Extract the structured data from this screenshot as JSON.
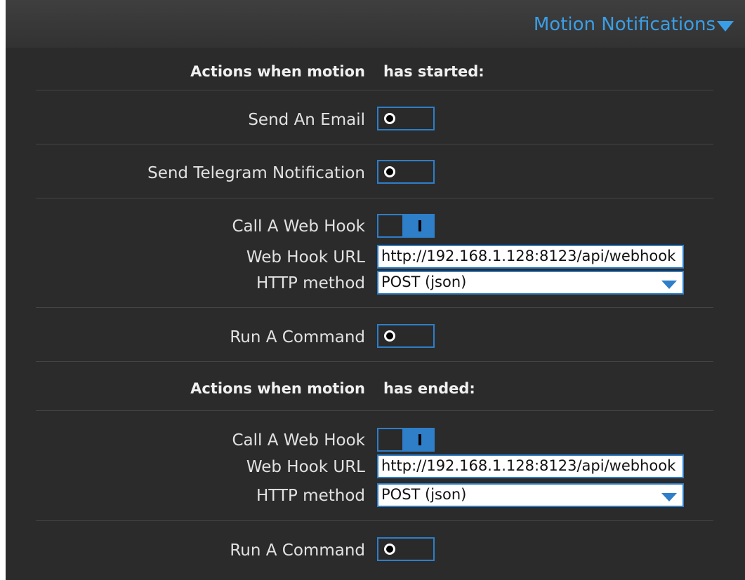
{
  "header": {
    "title": "Motion Notifications"
  },
  "started": {
    "heading_left": "Actions when motion",
    "heading_right": "has started:",
    "email_label": "Send An Email",
    "telegram_label": "Send Telegram Notification",
    "webhook_label": "Call A Web Hook",
    "webhook_url_label": "Web Hook URL",
    "webhook_url_value": "http://192.168.1.128:8123/api/webhook",
    "http_method_label": "HTTP method",
    "http_method_value": "POST (json)",
    "command_label": "Run A Command"
  },
  "ended": {
    "heading_left": "Actions when motion",
    "heading_right": "has ended:",
    "webhook_label": "Call A Web Hook",
    "webhook_url_label": "Web Hook URL",
    "webhook_url_value": "http://192.168.1.128:8123/api/webhook",
    "http_method_label": "HTTP method",
    "http_method_value": "POST (json)",
    "command_label": "Run A Command"
  },
  "colors": {
    "accent": "#2e7ec9",
    "header_text": "#3a9ee6",
    "background": "#2b2b2b"
  }
}
